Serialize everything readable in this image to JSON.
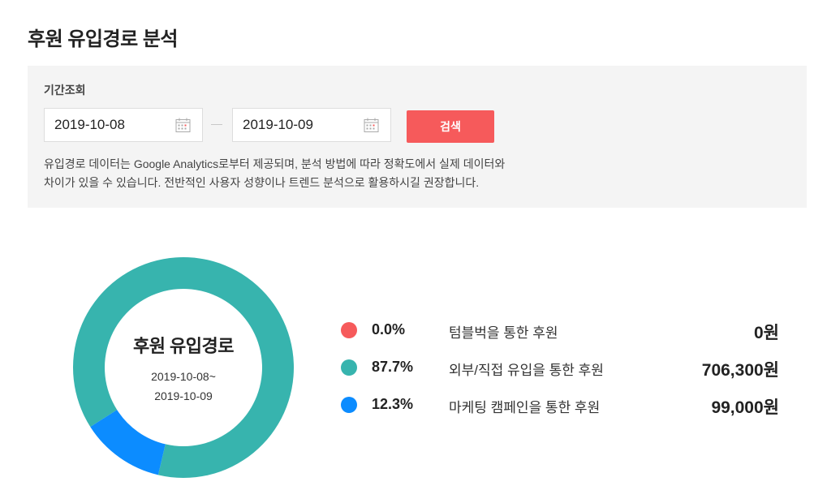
{
  "page": {
    "title": "후원 유입경로 분석"
  },
  "filter": {
    "label": "기간조회",
    "start_date": "2019-10-08",
    "end_date": "2019-10-09",
    "search_label": "검색",
    "notice_line1": "유입경로 데이터는 Google Analytics로부터 제공되며, 분석 방법에 따라 정확도에서 실제 데이터와",
    "notice_line2": "차이가 있을 수 있습니다. 전반적인 사용자 성향이나 트렌드 분석으로 활용하시길 권장합니다."
  },
  "icons": {
    "calendar": "calendar-icon"
  },
  "colors": {
    "accent_button": "#f65a5b",
    "tumblbug": "#f65a5b",
    "external": "#37b4ae",
    "marketing": "#0c8cff"
  },
  "donut": {
    "title": "후원 유입경로",
    "range_line1": "2019-10-08~",
    "range_line2": "2019-10-09"
  },
  "chart_data": {
    "type": "pie",
    "title": "후원 유입경로",
    "categories": [
      "텀블벅을 통한 후원",
      "외부/직접 유입을 통한 후원",
      "마케팅 캠페인을 통한 후원"
    ],
    "values": [
      0.0,
      87.7,
      12.3
    ],
    "amounts": [
      0,
      706300,
      99000
    ],
    "colors": [
      "#f65a5b",
      "#37b4ae",
      "#0c8cff"
    ]
  },
  "legend": [
    {
      "pct": "0.0%",
      "label": "텀블벅을 통한 후원",
      "amount": "0원",
      "color": "#f65a5b"
    },
    {
      "pct": "87.7%",
      "label": "외부/직접 유입을 통한 후원",
      "amount": "706,300원",
      "color": "#37b4ae"
    },
    {
      "pct": "12.3%",
      "label": "마케팅 캠페인을 통한 후원",
      "amount": "99,000원",
      "color": "#0c8cff"
    }
  ]
}
